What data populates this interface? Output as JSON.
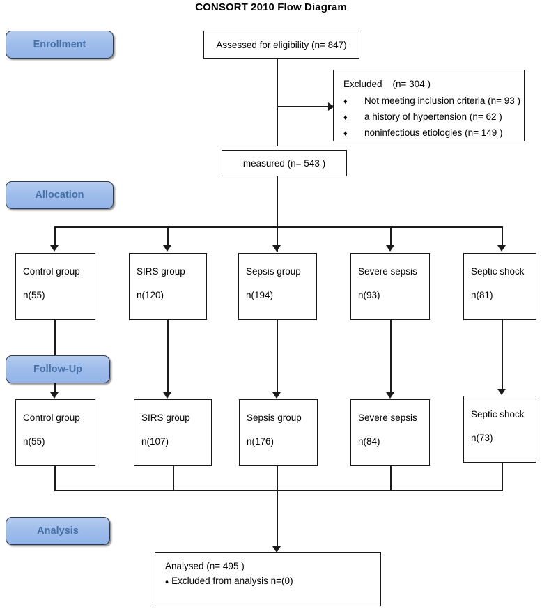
{
  "diagram": {
    "title": "CONSORT 2010 Flow Diagram",
    "accent_color": "#9fbdeb",
    "stage_text_color": "#4472a8",
    "line_color": "#1a1a1a"
  },
  "stages": [
    {
      "id": "enrollment",
      "label": "Enrollment"
    },
    {
      "id": "allocation",
      "label": "Allocation"
    },
    {
      "id": "followup",
      "label": "Follow-Up"
    },
    {
      "id": "analysis",
      "label": "Analysis"
    }
  ],
  "nodes": {
    "assessed": {
      "label": "Assessed for eligibility (n= 847)"
    },
    "measured": {
      "label": "measured (n= 543 )"
    },
    "excluded": {
      "heading": "Excluded    (n= 304 )",
      "bullet_glyph": "♦",
      "items": [
        "Not meeting inclusion criteria (n= 93 )",
        "a history of hypertension (n= 62 )",
        "noninfectious etiologies (n= 149 )"
      ]
    },
    "analysed": {
      "line1": "Analysed (n= 495 )",
      "bullet_glyph": "♦",
      "line2": "Excluded from analysis  n=(0)"
    }
  },
  "allocation_groups": [
    {
      "name": "Control group",
      "n": "n(55)"
    },
    {
      "name": "SIRS group",
      "n": "n(120)"
    },
    {
      "name": "Sepsis group",
      "n": "n(194)"
    },
    {
      "name": "Severe sepsis",
      "n": "n(93)"
    },
    {
      "name": "Septic shock",
      "n": "n(81)"
    }
  ],
  "followup_groups": [
    {
      "name": "Control group",
      "n": "n(55)"
    },
    {
      "name": "SIRS group",
      "n": "n(107)"
    },
    {
      "name": "Sepsis group",
      "n": "n(176)"
    },
    {
      "name": "Severe sepsis",
      "n": "n(84)"
    },
    {
      "name": "Septic shock",
      "n": "n(73)"
    }
  ]
}
